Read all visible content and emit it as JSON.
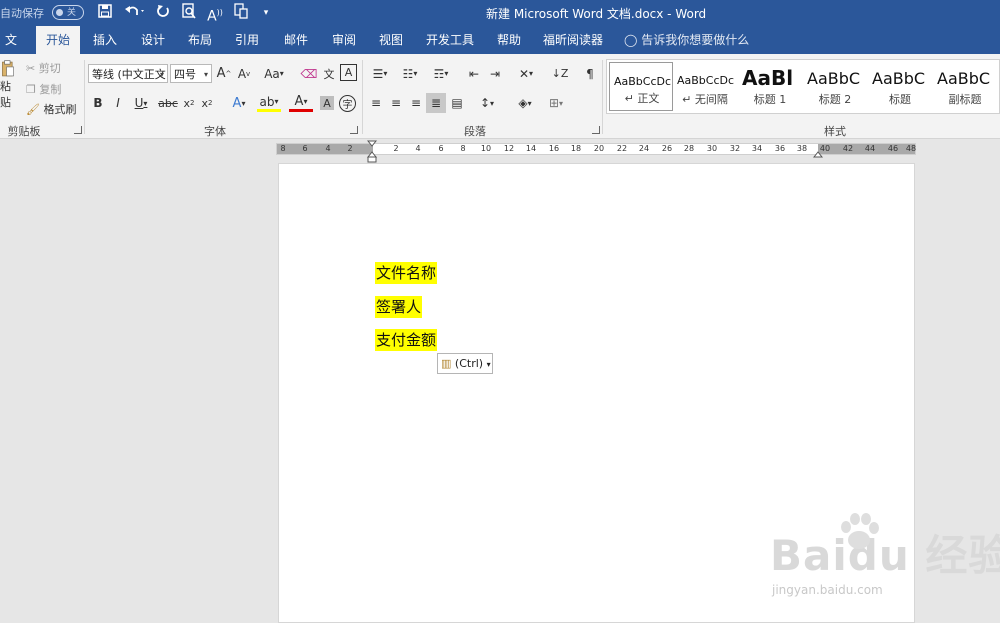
{
  "titlebar": {
    "autosave_label": "自动保存",
    "autosave_state": "关",
    "doc_title": "新建 Microsoft Word 文档.docx  -  Word"
  },
  "tabs": [
    "文件",
    "开始",
    "插入",
    "设计",
    "布局",
    "引用",
    "邮件",
    "审阅",
    "视图",
    "开发工具",
    "帮助",
    "福昕阅读器"
  ],
  "active_tab": "开始",
  "tell_me": "告诉我你想要做什么",
  "clipboard": {
    "paste": "粘贴",
    "cut": "剪切",
    "copy": "复制",
    "format_painter": "格式刷",
    "group_label": "剪贴板"
  },
  "font": {
    "name": "等线 (中文正文",
    "size": "四号",
    "change_case": "Aa",
    "group_label": "字体"
  },
  "paragraph": {
    "group_label": "段落"
  },
  "styles": {
    "items": [
      {
        "sample": "AaBbCcDc",
        "name": "↵ 正文",
        "big": false,
        "selected": true
      },
      {
        "sample": "AaBbCcDc",
        "name": "↵ 无间隔",
        "big": false,
        "selected": false
      },
      {
        "sample": "AaBl",
        "name": "标题 1",
        "big": true,
        "selected": false
      },
      {
        "sample": "AaBbC",
        "name": "标题 2",
        "big": false,
        "selected": false
      },
      {
        "sample": "AaBbC",
        "name": "标题",
        "big": false,
        "selected": false
      },
      {
        "sample": "AaBbC",
        "name": "副标题",
        "big": false,
        "selected": false
      }
    ],
    "group_label": "样式"
  },
  "ruler": {
    "ticks": [
      "8",
      "6",
      "4",
      "2",
      "2",
      "4",
      "6",
      "8",
      "10",
      "12",
      "14",
      "16",
      "18",
      "20",
      "22",
      "24",
      "26",
      "28",
      "30",
      "32",
      "34",
      "36",
      "38",
      "40",
      "42",
      "44",
      "46",
      "48"
    ]
  },
  "document": {
    "paragraphs": [
      "文件名称",
      "签署人",
      "支付金额"
    ],
    "highlight_color": "#ffff00",
    "paste_options": "(Ctrl)"
  },
  "watermark": {
    "logo": "Baidu 经验",
    "url": "jingyan.baidu.com"
  },
  "colors": {
    "word_blue": "#2b579a",
    "ribbon": "#f3f3f3",
    "canvas": "#e6e6e6"
  }
}
